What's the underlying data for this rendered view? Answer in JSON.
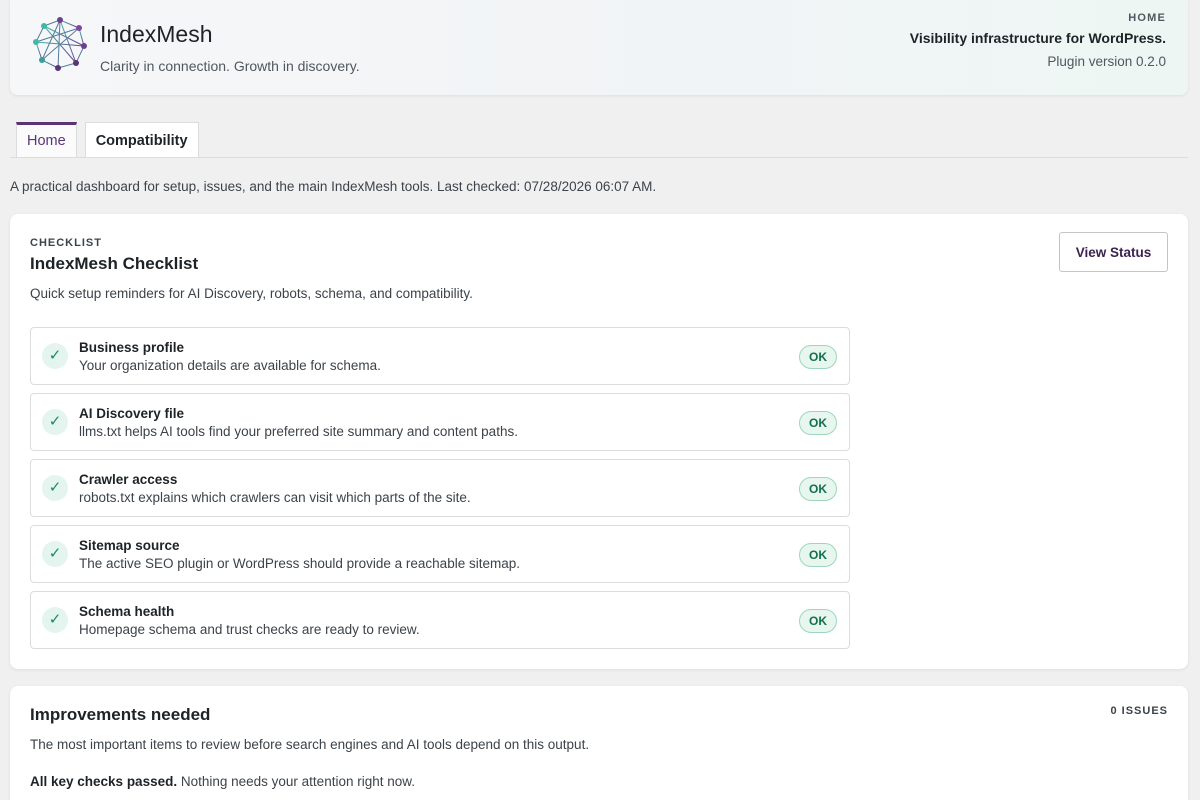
{
  "header": {
    "brand_name": "IndexMesh",
    "tagline": "Clarity in connection. Growth in discovery.",
    "breadcrumb": "HOME",
    "heading": "Visibility infrastructure for WordPress.",
    "version": "Plugin version 0.2.0"
  },
  "tabs": [
    {
      "label": "Home",
      "active": true
    },
    {
      "label": "Compatibility",
      "active": false
    }
  ],
  "intro": "A practical dashboard for setup, issues, and the main IndexMesh tools. Last checked: 07/28/2026 06:07 AM.",
  "checklist": {
    "eyebrow": "CHECKLIST",
    "title": "IndexMesh Checklist",
    "subtitle": "Quick setup reminders for AI Discovery, robots, schema, and compatibility.",
    "button_label": "View Status",
    "items": [
      {
        "title": "Business profile",
        "description": "Your organization details are available for schema.",
        "status": "OK"
      },
      {
        "title": "AI Discovery file",
        "description": "llms.txt helps AI tools find your preferred site summary and content paths.",
        "status": "OK"
      },
      {
        "title": "Crawler access",
        "description": "robots.txt explains which crawlers can visit which parts of the site.",
        "status": "OK"
      },
      {
        "title": "Sitemap source",
        "description": "The active SEO plugin or WordPress should provide a reachable sitemap.",
        "status": "OK"
      },
      {
        "title": "Schema health",
        "description": "Homepage schema and trust checks are ready to review.",
        "status": "OK"
      }
    ]
  },
  "improvements": {
    "title": "Improvements needed",
    "issue_count": "0 ISSUES",
    "subtitle": "The most important items to review before search engines and AI tools depend on this output.",
    "status_strong": "All key checks passed.",
    "status_rest": " Nothing needs your attention right now."
  },
  "colors": {
    "accent": "#5b3478",
    "ok_text": "#13714a",
    "ok_bg": "#e7f6ef",
    "page_bg": "#f0f0f1"
  },
  "icons": {
    "logo": "network-mesh-logo",
    "check": "checkmark-icon"
  }
}
